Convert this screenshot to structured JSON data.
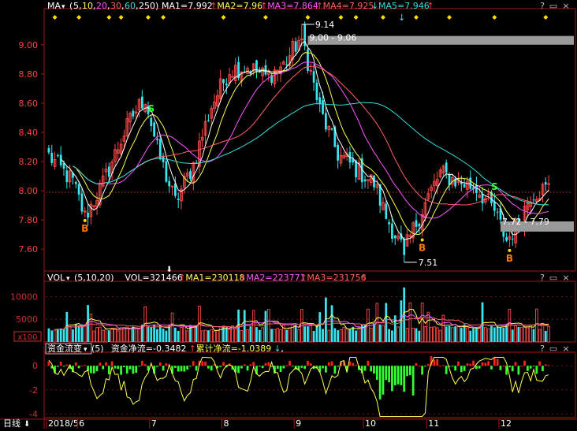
{
  "colors": {
    "up": "#ff4a4a",
    "down": "#38e6f0",
    "ma1": "#ffffff",
    "ma2": "#ffff55",
    "ma3": "#ff55ff",
    "ma4": "#ff6060",
    "ma5": "#33dddd",
    "flow_pos": "#ff2020",
    "flow_neg": "#33ff33",
    "frame": "#a01818",
    "axis_text_main": "#ff4040",
    "axis_text_sub": "#c83030",
    "marker_b": "#ff7700",
    "marker_s": "#33ff33",
    "diamond": "#ffdd00"
  },
  "main_header": {
    "name": "MA",
    "params_label": "(5,10,20,30,60,250)",
    "params": [
      {
        "text": "5",
        "color": "#ffffff"
      },
      {
        "text": "10",
        "color": "#ffff55"
      },
      {
        "text": "20",
        "color": "#ff55ff"
      },
      {
        "text": "30",
        "color": "#ff6060"
      },
      {
        "text": "60",
        "color": "#33dddd"
      },
      {
        "text": "250",
        "color": "#ffffff"
      }
    ],
    "items": [
      {
        "label": "MA1=7.992",
        "color": "#ffffff",
        "arrow": "↑",
        "arrow_color": "#ff4040"
      },
      {
        "label": "MA2=7.96",
        "color": "#ffff55",
        "arrow": "↑",
        "arrow_color": "#ff4040"
      },
      {
        "label": "MA3=7.864",
        "color": "#ff55ff",
        "arrow": "↑",
        "arrow_color": "#ff4040"
      },
      {
        "label": "MA4=7.925",
        "color": "#ff6060",
        "arrow": "↓",
        "arrow_color": "#33dddd"
      },
      {
        "label": "MA5=7.946",
        "color": "#33dddd",
        "arrow": "↑",
        "arrow_color": "#ff4040"
      }
    ],
    "controls": [
      "?",
      "▭",
      "×"
    ]
  },
  "vol_header": {
    "name": "VOL",
    "params_label": "(5,10,20)",
    "items": [
      {
        "label": "VOL=321466",
        "color": "#ffffff",
        "arrow": "↑",
        "arrow_color": "#ff4040"
      },
      {
        "label": "MA1=230118",
        "color": "#ffff55",
        "arrow": "↑",
        "arrow_color": "#ff4040"
      },
      {
        "label": "MA2=223771",
        "color": "#ff55ff",
        "arrow": "↑",
        "arrow_color": "#ff4040"
      },
      {
        "label": "MA3=231756",
        "color": "#ff6060",
        "arrow": "↑",
        "arrow_color": "#ff4040"
      }
    ],
    "controls": [
      "?",
      "▭",
      "×"
    ]
  },
  "flow_header": {
    "name": "资金流变",
    "params_label": "(5)",
    "items": [
      {
        "label": "资金净流=-0.3482",
        "color": "#ffffff",
        "arrow": "↑",
        "arrow_color": "#ff4040"
      },
      {
        "label": "累计净流=-1.0389",
        "color": "#ffff55",
        "arrow": "↓",
        "arrow_color": "#33dddd"
      },
      {
        "label": ",",
        "color": "#ffffff",
        "arrow": "",
        "arrow_color": "#ffffff"
      }
    ],
    "controls": [
      "?",
      "▭",
      "×"
    ]
  },
  "bottom": {
    "period_label": "日线",
    "period_arrow": "⬇",
    "date_labels": [
      "2018/5",
      "6",
      "7",
      "8",
      "9",
      "10",
      "11",
      "12"
    ]
  },
  "annotations": {
    "high_label": "9.14",
    "range_top": "9.00 - 9.06",
    "range_bottom": "7.72 - 7.79",
    "low_label": "7.51",
    "b_label": "B",
    "s_label": "S"
  },
  "vol_unit_label": "x100",
  "chart_data": [
    {
      "type": "candlestick",
      "ylim": [
        7.45,
        9.22
      ],
      "yticks": [
        "9.00",
        "8.80",
        "8.60",
        "8.40",
        "8.20",
        "8.00",
        "7.80",
        "7.60"
      ],
      "reference_line": 7.99,
      "highlight_bands": [
        [
          9.0,
          9.06
        ],
        [
          7.72,
          7.79
        ]
      ],
      "buy_signals_at_index": [
        12,
        124,
        153
      ],
      "sell_signals_at_index": [
        34,
        148
      ],
      "high_at_index": 84,
      "low_at_index": 118,
      "key_points": [
        [
          0,
          8.24
        ],
        [
          8,
          8.06
        ],
        [
          12,
          7.82
        ],
        [
          18,
          8.05
        ],
        [
          24,
          8.35
        ],
        [
          28,
          8.52
        ],
        [
          32,
          8.64
        ],
        [
          36,
          8.28
        ],
        [
          42,
          7.92
        ],
        [
          48,
          8.18
        ],
        [
          54,
          8.58
        ],
        [
          60,
          8.83
        ],
        [
          66,
          8.85
        ],
        [
          72,
          8.78
        ],
        [
          78,
          8.86
        ],
        [
          84,
          9.06
        ],
        [
          90,
          8.55
        ],
        [
          96,
          8.25
        ],
        [
          102,
          8.15
        ],
        [
          108,
          8.05
        ],
        [
          112,
          7.82
        ],
        [
          118,
          7.58
        ],
        [
          122,
          7.78
        ],
        [
          126,
          7.96
        ],
        [
          130,
          8.12
        ],
        [
          136,
          8.06
        ],
        [
          142,
          8.02
        ],
        [
          148,
          7.86
        ],
        [
          152,
          7.66
        ],
        [
          156,
          7.78
        ],
        [
          160,
          7.98
        ],
        [
          166,
          8.02
        ]
      ],
      "series": [
        {
          "name": "MA1",
          "period": 5
        },
        {
          "name": "MA2",
          "period": 10
        },
        {
          "name": "MA3",
          "period": 20
        },
        {
          "name": "MA4",
          "period": 30
        },
        {
          "name": "MA5",
          "period": 60
        }
      ]
    },
    {
      "type": "bar",
      "yticks": [
        "10000",
        "5000"
      ],
      "ylim": [
        0,
        12500
      ],
      "series": [
        {
          "name": "VOL"
        },
        {
          "name": "MA1"
        },
        {
          "name": "MA2"
        },
        {
          "name": "MA3"
        }
      ]
    },
    {
      "type": "bar",
      "yticks": [
        "0",
        "-2",
        "-4"
      ],
      "ylim": [
        -4.3,
        0.8
      ],
      "series": [
        {
          "name": "资金净流"
        },
        {
          "name": "累计净流"
        }
      ]
    }
  ]
}
